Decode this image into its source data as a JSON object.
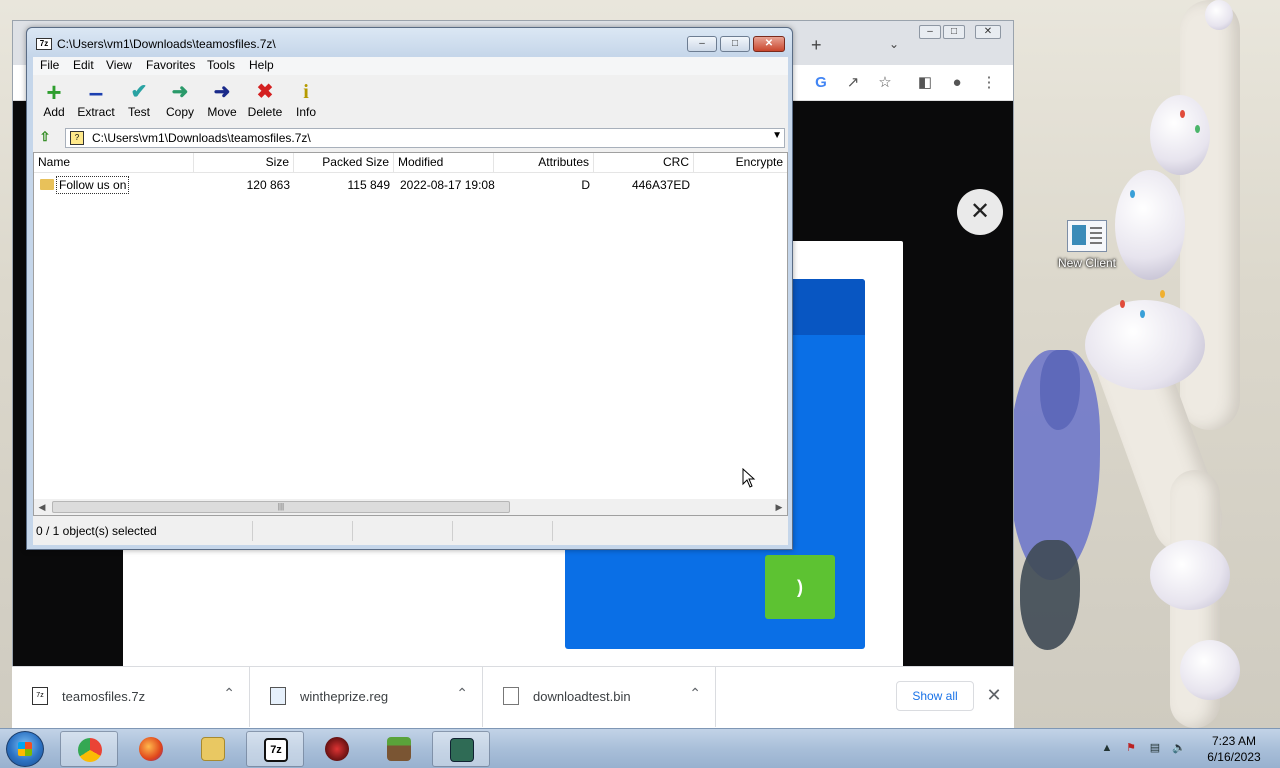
{
  "desktop": {
    "icon_label": "New Client"
  },
  "chrome": {
    "downloads": [
      {
        "name": "teamosfiles.7z",
        "icon": "7z-file-icon"
      },
      {
        "name": "wintheprize.reg",
        "icon": "reg-file-icon"
      },
      {
        "name": "downloadtest.bin",
        "icon": "generic-file-icon"
      }
    ],
    "show_all_label": "Show all"
  },
  "sevenzip": {
    "title": "C:\\Users\\vm1\\Downloads\\teamosfiles.7z\\",
    "menu": [
      "File",
      "Edit",
      "View",
      "Favorites",
      "Tools",
      "Help"
    ],
    "toolbar": [
      {
        "label": "Add",
        "icon": "add-icon",
        "color": "#2e9e2e"
      },
      {
        "label": "Extract",
        "icon": "extract-icon",
        "color": "#1c3fb0"
      },
      {
        "label": "Test",
        "icon": "test-icon",
        "color": "#2aa3a3"
      },
      {
        "label": "Copy",
        "icon": "copy-icon",
        "color": "#2a9a6a"
      },
      {
        "label": "Move",
        "icon": "move-icon",
        "color": "#1a2a8a"
      },
      {
        "label": "Delete",
        "icon": "delete-icon",
        "color": "#d42020"
      },
      {
        "label": "Info",
        "icon": "info-icon",
        "color": "#b59a00"
      }
    ],
    "address": "C:\\Users\\vm1\\Downloads\\teamosfiles.7z\\",
    "columns": [
      "Name",
      "Size",
      "Packed Size",
      "Modified",
      "Attributes",
      "CRC",
      "Encrypte"
    ],
    "rows": [
      {
        "name": "Follow us on",
        "size": "120 863",
        "packed": "115 849",
        "modified": "2022-08-17 19:08",
        "attributes": "D",
        "crc": "446A37ED"
      }
    ],
    "status": "0 / 1 object(s) selected"
  },
  "taskbar": {
    "time": "7:23 AM",
    "date": "6/16/2023"
  }
}
